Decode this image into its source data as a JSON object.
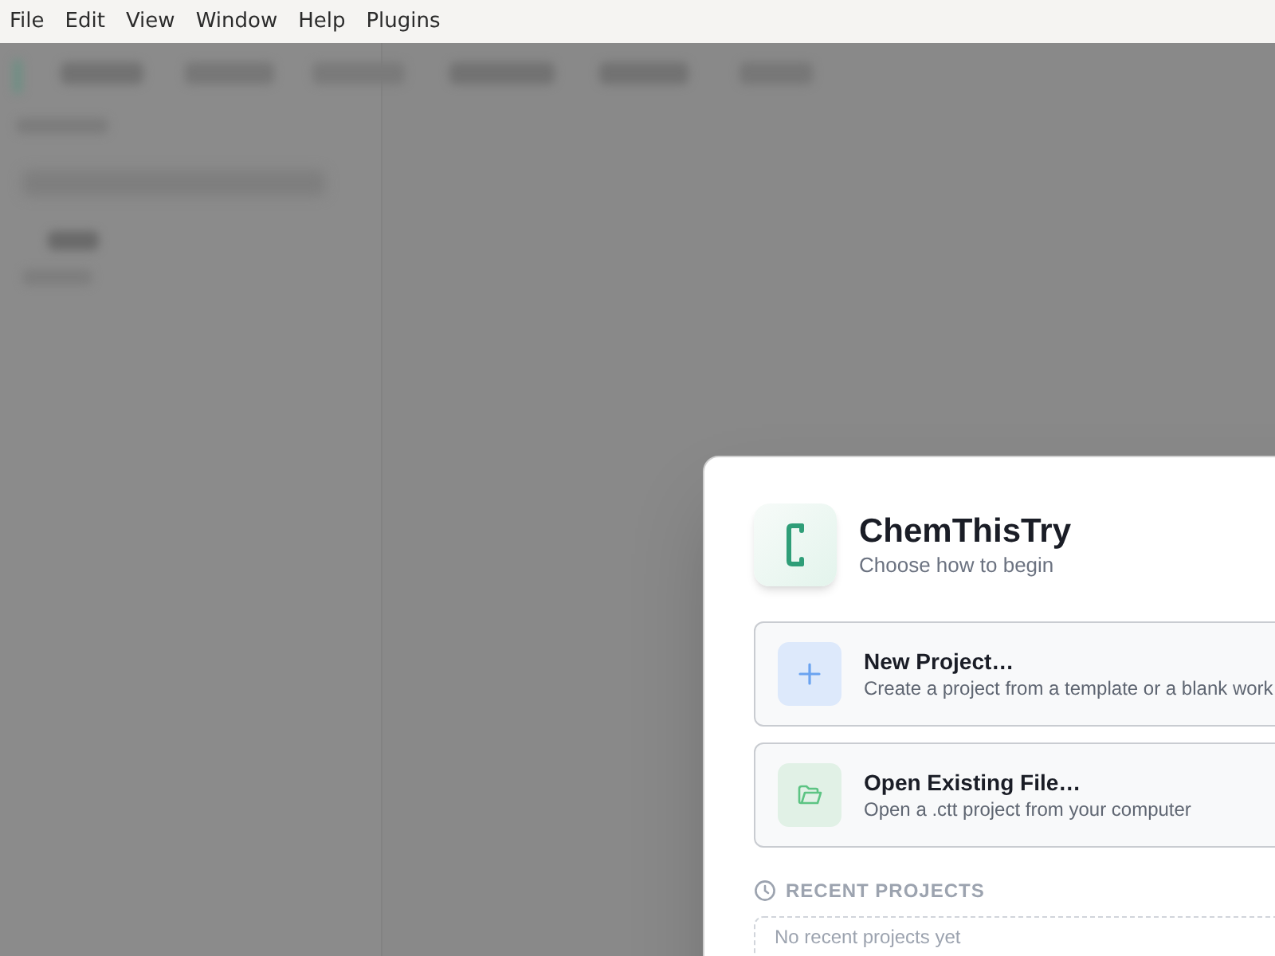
{
  "menu_bar": [
    "File",
    "Edit",
    "View",
    "Window",
    "Help",
    "Plugins"
  ],
  "dialog": {
    "title": "ChemThisTry",
    "subtitle": "Choose how to begin",
    "actions": [
      {
        "kind": "new",
        "title": "New Project…",
        "description": "Create a project from a template or a blank work"
      },
      {
        "kind": "open",
        "title": "Open Existing File…",
        "description": "Open a .ctt project from your computer"
      }
    ],
    "recent_heading": "RECENT PROJECTS",
    "recent_empty": "No recent projects yet"
  }
}
